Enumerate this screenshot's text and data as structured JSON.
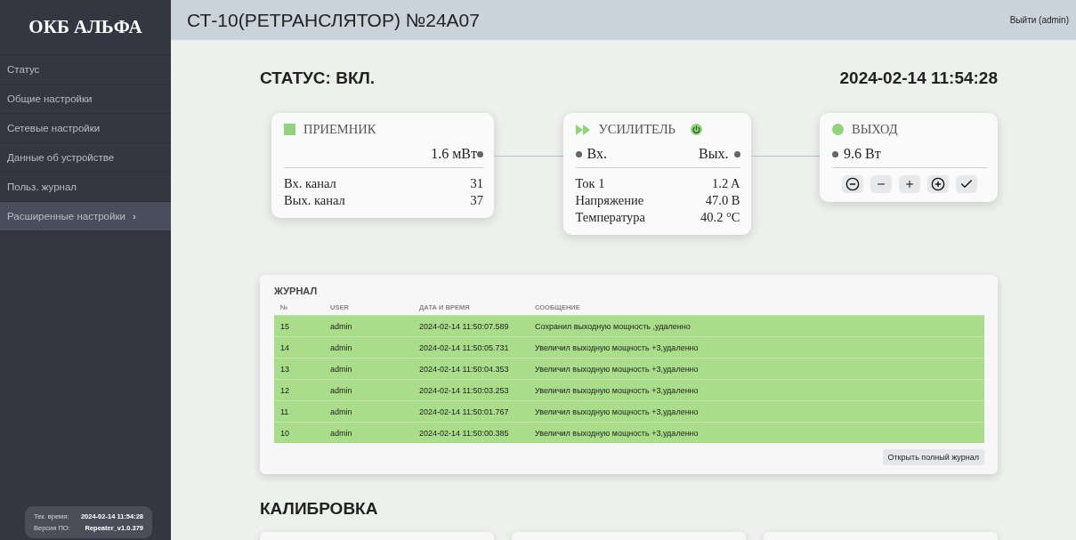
{
  "sidebar": {
    "logo": "ОКБ АЛЬФА",
    "items": [
      {
        "label": "Статус",
        "selected": false
      },
      {
        "label": "Общие настройки",
        "selected": false
      },
      {
        "label": "Сетевые настройки",
        "selected": false
      },
      {
        "label": "Данные об устройстве",
        "selected": false
      },
      {
        "label": "Польз. журнал",
        "selected": false
      },
      {
        "label": "Расширенные настройки",
        "selected": true,
        "arrow": "›"
      }
    ],
    "info": [
      {
        "label": "Тек. время:",
        "value": "2024-02-14 11:54:28"
      },
      {
        "label": "Версия ПО:",
        "value": "Repeater_v1.0.379"
      }
    ]
  },
  "header": {
    "title": "СТ-10(РЕТРАНСЛЯТОР) №24А07",
    "logout": "Выйти (admin)"
  },
  "status": {
    "title": "СТАТУС: ВКЛ.",
    "datetime": "2024-02-14 11:54:28"
  },
  "receiver": {
    "title": "ПРИЕМНИК",
    "power": "1.6 мВт",
    "rows": [
      {
        "label": "Вх. канал",
        "value": "31"
      },
      {
        "label": "Вых. канал",
        "value": "37"
      }
    ]
  },
  "amplifier": {
    "title": "УСИЛИТЕЛЬ",
    "input": "Вх.",
    "output": "Вых.",
    "rows": [
      {
        "label": "Ток 1",
        "value": "1.2 A"
      },
      {
        "label": "Напряжение",
        "value": "47.0 B"
      },
      {
        "label": "Температура",
        "value": "40.2 °C"
      }
    ]
  },
  "output": {
    "title": "ВЫХОД",
    "power": "9.6 Вт"
  },
  "journal": {
    "title": "ЖУРНАЛ",
    "columns": [
      "№",
      "USER",
      "ДАТА И ВРЕМЯ",
      "СООБЩЕНИЕ"
    ],
    "rows": [
      [
        "15",
        "admin",
        "2024-02-14 11:50:07.589",
        "Сохранил выходную мощность ,удаленно"
      ],
      [
        "14",
        "admin",
        "2024-02-14 11:50:05.731",
        "Увеличил выходную мощность +3,удаленно"
      ],
      [
        "13",
        "admin",
        "2024-02-14 11:50:04.353",
        "Увеличил выходную мощность +3,удаленно"
      ],
      [
        "12",
        "admin",
        "2024-02-14 11:50:03.253",
        "Увеличил выходную мощность +3,удаленно"
      ],
      [
        "11",
        "admin",
        "2024-02-14 11:50:01.767",
        "Увеличил выходную мощность +3,удаленно"
      ],
      [
        "10",
        "admin",
        "2024-02-14 11:50:00.385",
        "Увеличил выходную мощность +3,удаленно"
      ]
    ],
    "open_button": "Открыть полный журнал"
  },
  "calibration": {
    "title": "КАЛИБРОВКА"
  }
}
